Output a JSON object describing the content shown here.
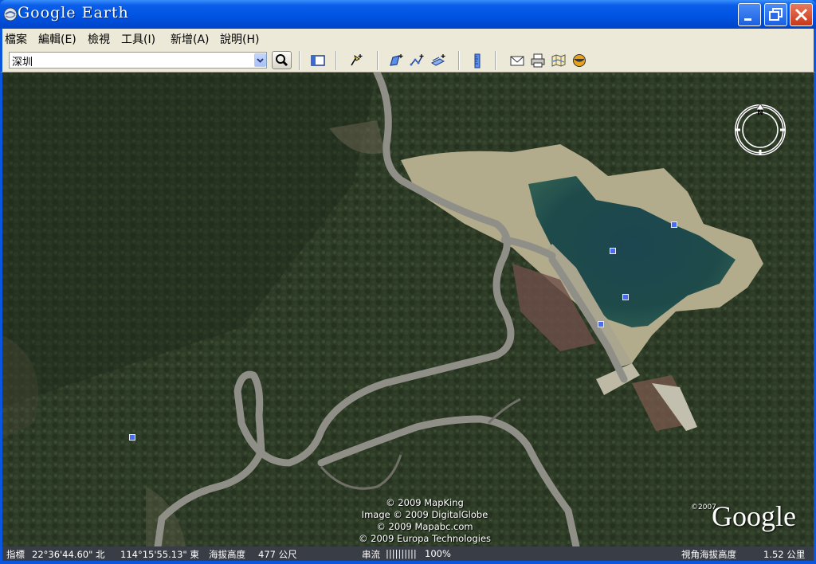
{
  "window": {
    "title": "Google Earth"
  },
  "menu": {
    "items": [
      {
        "label": "檔案"
      },
      {
        "label": "編輯(E)"
      },
      {
        "label": "檢視"
      },
      {
        "label": "工具(I)"
      },
      {
        "label": "新增(A)"
      },
      {
        "label": "說明(H)"
      }
    ]
  },
  "search": {
    "value": "深圳"
  },
  "toolbar": {
    "icons": [
      "sidebar-toggle-icon",
      "add-placemark-icon",
      "add-polygon-icon",
      "add-path-icon",
      "add-image-overlay-icon",
      "ruler-icon",
      "email-icon",
      "print-icon",
      "google-maps-icon",
      "sky-toggle-icon"
    ]
  },
  "map": {
    "compass_label": "N",
    "copyright": [
      "© 2009 MapKing",
      "Image © 2009 DigitalGlobe",
      "© 2009 Mapabc.com",
      "© 2009 Europa Technologies"
    ],
    "logo": "Google",
    "logo_year": "©2007",
    "colors": {
      "forest": "#2c3a26",
      "reservoir": "#1f4a4e",
      "road": "#8f8f87",
      "placemark": "#4a6cf0"
    }
  },
  "status": {
    "pointer_label": "指標",
    "latitude": "22°36'44.60\" 北",
    "longitude": "114°15'55.13\" 東",
    "elevation_label": "海拔高度",
    "elevation_value": "477 公尺",
    "streaming_label": "串流",
    "streaming_bars": "||||||||||",
    "streaming_value": "100%",
    "eye_alt_label": "視角海拔高度",
    "eye_alt_value": "1.52 公里"
  }
}
